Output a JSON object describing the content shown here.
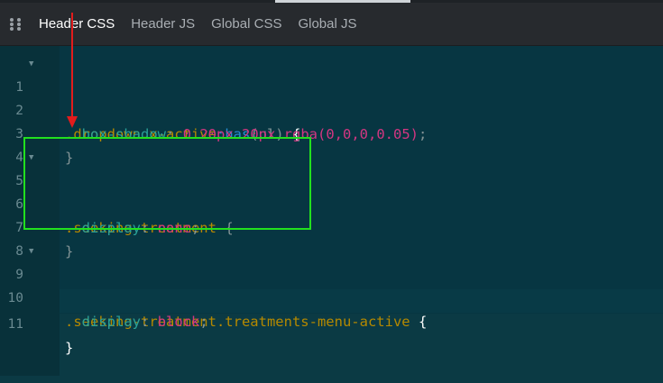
{
  "tabs": [
    {
      "label": "Header CSS",
      "active": true
    },
    {
      "label": "Header JS",
      "active": false
    },
    {
      "label": "Global CSS",
      "active": false
    },
    {
      "label": "Global JS",
      "active": false
    }
  ],
  "code": {
    "line_numbers": [
      "1",
      "2",
      "3",
      "4",
      "5",
      "6",
      "7",
      "8",
      "9",
      "10",
      "11"
    ],
    "l1": {
      "selector": ".dropdown.x-active",
      "pseudo": ":has",
      "arg": "(ul)",
      "brace": "{"
    },
    "l2": {
      "prop": "box-shadow",
      "sep": ":",
      "value": "0 20px 20px rgba(0,0,0,0.05)",
      "end": ";"
    },
    "l3": {
      "brace": "}"
    },
    "l5": {
      "selector": ".seeking-treatment",
      "brace": "{"
    },
    "l6": {
      "prop": "display",
      "sep": ":",
      "value": "none",
      "end": ";"
    },
    "l7": {
      "brace": "}"
    },
    "l9": {
      "selector": ".seeking-treatment.treatments-menu-active",
      "brace": "{"
    },
    "l10": {
      "prop": "display",
      "sep": ":",
      "value": "block",
      "end": ";"
    },
    "l11": {
      "brace": "}"
    }
  },
  "fold_markers": {
    "l1": "▼",
    "l5": "▼",
    "l9": "▼"
  },
  "colors": {
    "selector": "#b58900",
    "function": "#268bd2",
    "property": "#2aa198",
    "value": "#d33682",
    "annotation_box": "#22e01e",
    "annotation_arrow": "#e21c1c"
  }
}
